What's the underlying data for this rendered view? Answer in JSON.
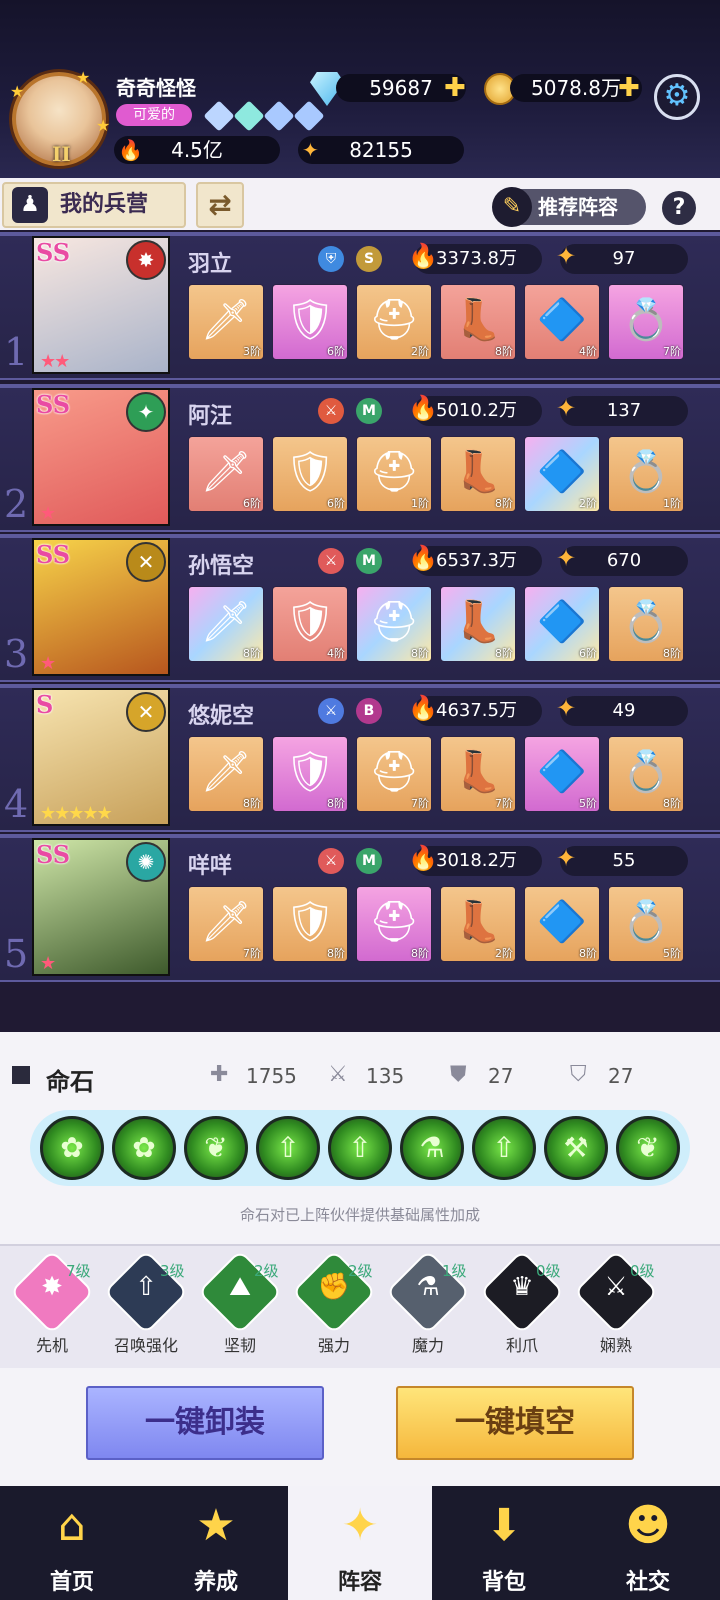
{
  "player": {
    "name": "奇奇怪怪",
    "title": "可爱的",
    "avatar_level": "II",
    "diamonds": "59687",
    "gold": "5078.8万",
    "power": "4.5亿",
    "stars": "82155"
  },
  "barracks": {
    "label": "我的兵营",
    "recommend_label": "推荐阵容",
    "help": "?"
  },
  "heroes": [
    {
      "index": "1",
      "rank": "SS",
      "name": "羽立",
      "grade": "S",
      "power": "3373.8万",
      "level": "97",
      "stars": "★★",
      "equip": [
        {
          "glyph": "🗡",
          "tier": "3阶",
          "q": "q-orange"
        },
        {
          "glyph": "🛡",
          "tier": "6阶",
          "q": "q-pink"
        },
        {
          "glyph": "⛑",
          "tier": "2阶",
          "q": "q-orange"
        },
        {
          "glyph": "👢",
          "tier": "8阶",
          "q": "q-red"
        },
        {
          "glyph": "🔷",
          "tier": "4阶",
          "q": "q-red"
        },
        {
          "glyph": "💍",
          "tier": "7阶",
          "q": "q-pink"
        }
      ]
    },
    {
      "index": "2",
      "rank": "SS",
      "name": "阿汪",
      "grade": "M",
      "power": "5010.2万",
      "level": "137",
      "stars": "★",
      "equip": [
        {
          "glyph": "🗡",
          "tier": "6阶",
          "q": "q-red"
        },
        {
          "glyph": "🛡",
          "tier": "6阶",
          "q": "q-orange"
        },
        {
          "glyph": "⛑",
          "tier": "1阶",
          "q": "q-orange"
        },
        {
          "glyph": "👢",
          "tier": "8阶",
          "q": "q-orange"
        },
        {
          "glyph": "🔷",
          "tier": "2阶",
          "q": "q-rainbow"
        },
        {
          "glyph": "💍",
          "tier": "1阶",
          "q": "q-orange"
        }
      ]
    },
    {
      "index": "3",
      "rank": "SS",
      "name": "孙悟空",
      "grade": "M",
      "power": "6537.3万",
      "level": "670",
      "stars": "★",
      "equip": [
        {
          "glyph": "🗡",
          "tier": "8阶",
          "q": "q-rainbow"
        },
        {
          "glyph": "🛡",
          "tier": "4阶",
          "q": "q-red"
        },
        {
          "glyph": "⛑",
          "tier": "8阶",
          "q": "q-rainbow"
        },
        {
          "glyph": "👢",
          "tier": "8阶",
          "q": "q-rainbow"
        },
        {
          "glyph": "🔷",
          "tier": "6阶",
          "q": "q-rainbow"
        },
        {
          "glyph": "💍",
          "tier": "8阶",
          "q": "q-orange"
        }
      ]
    },
    {
      "index": "4",
      "rank": "S",
      "name": "悠妮空",
      "grade": "B",
      "power": "4637.5万",
      "level": "49",
      "stars": "★★★★★",
      "equip": [
        {
          "glyph": "🗡",
          "tier": "8阶",
          "q": "q-orange"
        },
        {
          "glyph": "🛡",
          "tier": "8阶",
          "q": "q-pink"
        },
        {
          "glyph": "⛑",
          "tier": "7阶",
          "q": "q-orange"
        },
        {
          "glyph": "👢",
          "tier": "7阶",
          "q": "q-orange"
        },
        {
          "glyph": "🔷",
          "tier": "5阶",
          "q": "q-pink"
        },
        {
          "glyph": "💍",
          "tier": "8阶",
          "q": "q-orange"
        }
      ]
    },
    {
      "index": "5",
      "rank": "SS",
      "name": "咩咩",
      "grade": "M",
      "power": "3018.2万",
      "level": "55",
      "stars": "★",
      "equip": [
        {
          "glyph": "🗡",
          "tier": "7阶",
          "q": "q-orange"
        },
        {
          "glyph": "🛡",
          "tier": "8阶",
          "q": "q-orange"
        },
        {
          "glyph": "⛑",
          "tier": "8阶",
          "q": "q-pink"
        },
        {
          "glyph": "👢",
          "tier": "2阶",
          "q": "q-orange"
        },
        {
          "glyph": "🔷",
          "tier": "8阶",
          "q": "q-orange"
        },
        {
          "glyph": "💍",
          "tier": "5阶",
          "q": "q-orange"
        }
      ]
    }
  ],
  "fate_stone": {
    "title": "命石",
    "hp": "1755",
    "atk": "135",
    "def": "27",
    "mdef": "27",
    "note": "命石对已上阵伙伴提供基础属性加成"
  },
  "skills": [
    {
      "name": "先机",
      "level": "7级",
      "color": "#f07ac0"
    },
    {
      "name": "召唤强化",
      "level": "3级",
      "color": "#2d3b55"
    },
    {
      "name": "坚韧",
      "level": "2级",
      "color": "#2f8a3a"
    },
    {
      "name": "强力",
      "level": "2级",
      "color": "#2f8a3a"
    },
    {
      "name": "魔力",
      "level": "1级",
      "color": "#56606e"
    },
    {
      "name": "利爪",
      "level": "0级",
      "color": "#1c1c24"
    },
    {
      "name": "娴熟",
      "level": "0级",
      "color": "#1c1c24"
    }
  ],
  "actions": {
    "unequip": "一键卸装",
    "fill": "一键填空"
  },
  "nav": [
    {
      "label": "首页",
      "icon": "home-icon"
    },
    {
      "label": "养成",
      "icon": "star-icon"
    },
    {
      "label": "阵容",
      "icon": "lineup-icon"
    },
    {
      "label": "背包",
      "icon": "bag-icon"
    },
    {
      "label": "社交",
      "icon": "social-icon"
    }
  ]
}
